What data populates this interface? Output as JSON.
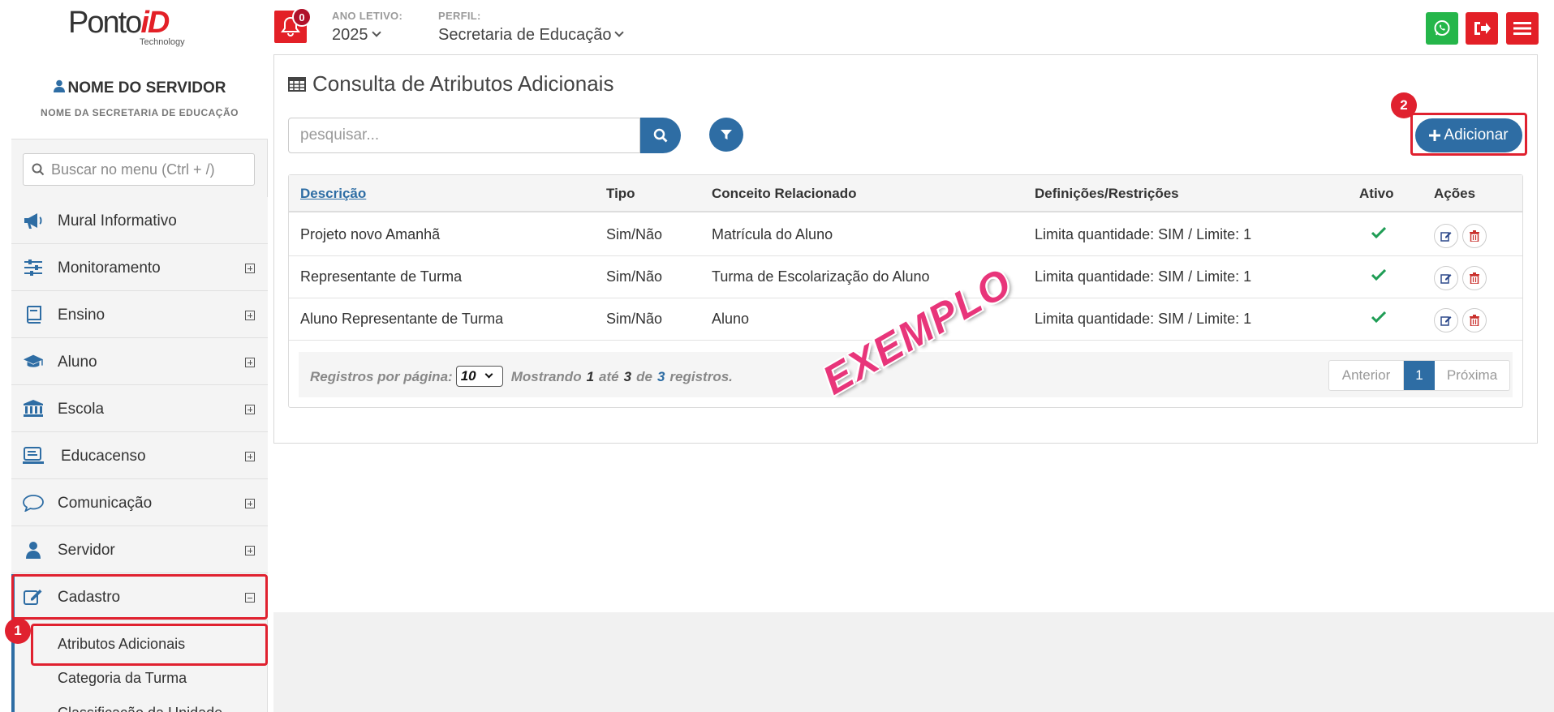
{
  "header": {
    "logo": {
      "main": "Ponto",
      "accent": "iD",
      "sub": "Technology"
    },
    "notifications_count": "0",
    "ano_letivo_label": "ANO LETIVO:",
    "ano_letivo_value": "2025",
    "perfil_label": "PERFIL:",
    "perfil_value": "Secretaria de Educação",
    "colors": {
      "whatsapp": "#25b64a",
      "red": "#e32027",
      "blue": "#2e6da4"
    }
  },
  "sidebar": {
    "user_name": "NOME DO SERVIDOR",
    "user_secretaria": "NOME DA SECRETARIA DE EDUCAÇÃO",
    "search_placeholder": "Buscar no menu (Ctrl + /)",
    "items": [
      {
        "label": "Mural Informativo",
        "icon": "megaphone-icon"
      },
      {
        "label": "Monitoramento",
        "icon": "sliders-icon"
      },
      {
        "label": "Ensino",
        "icon": "book-icon"
      },
      {
        "label": "Aluno",
        "icon": "graduation-cap-icon"
      },
      {
        "label": "Escola",
        "icon": "institution-icon"
      },
      {
        "label": "Educacenso",
        "icon": "monitor-icon"
      },
      {
        "label": "Comunicação",
        "icon": "chat-bubble-icon"
      },
      {
        "label": "Servidor",
        "icon": "user-icon"
      },
      {
        "label": "Cadastro",
        "icon": "edit-icon"
      }
    ],
    "sub_items": [
      {
        "label": "Atributos Adicionais"
      },
      {
        "label": "Categoria da Turma"
      },
      {
        "label": "Classificação da Unidade"
      }
    ]
  },
  "steps": {
    "one": "1",
    "two": "2"
  },
  "main": {
    "title": "Consulta de Atributos Adicionais",
    "search_placeholder": "pesquisar...",
    "add_label": "Adicionar",
    "table": {
      "columns": [
        "Descrição",
        "Tipo",
        "Conceito Relacionado",
        "Definições/Restrições",
        "Ativo",
        "Ações"
      ],
      "rows": [
        {
          "descricao": "Projeto novo Amanhã",
          "tipo": "Sim/Não",
          "conceito": "Matrícula do Aluno",
          "definicoes": "Limita quantidade: SIM / Limite: 1",
          "ativo": true
        },
        {
          "descricao": "Representante de Turma",
          "tipo": "Sim/Não",
          "conceito": "Turma de Escolarização do Aluno",
          "definicoes": "Limita quantidade: SIM / Limite: 1",
          "ativo": true
        },
        {
          "descricao": "Aluno Representante de Turma",
          "tipo": "Sim/Não",
          "conceito": "Aluno",
          "definicoes": "Limita quantidade: SIM / Limite: 1",
          "ativo": true
        }
      ]
    },
    "footer": {
      "per_page_label": "Registros por página:",
      "per_page_value": "10",
      "showing": "Mostrando",
      "from": "1",
      "ate": "até",
      "to": "3",
      "de": "de",
      "total": "3",
      "registros": "registros."
    },
    "pagination": {
      "prev": "Anterior",
      "current": "1",
      "next": "Próxima"
    },
    "watermark": "EXEMPLO"
  }
}
